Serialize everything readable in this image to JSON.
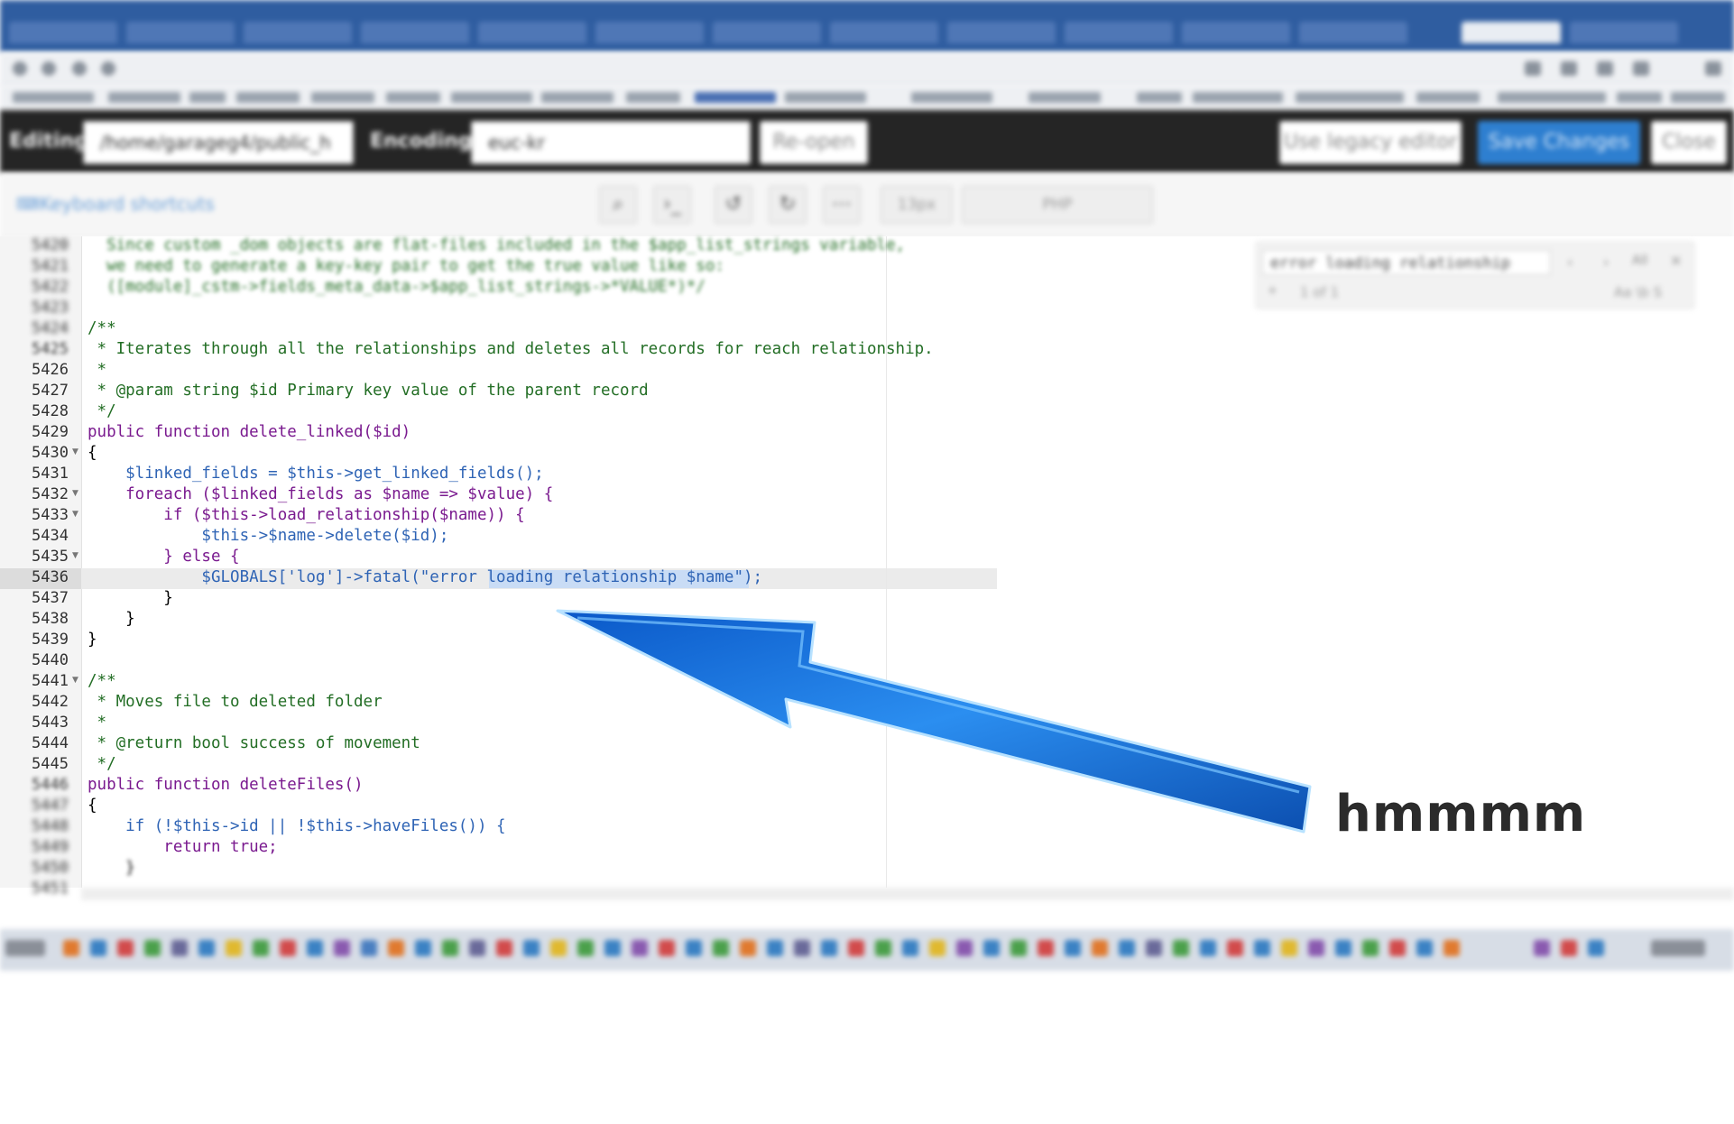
{
  "editor_bar": {
    "editing_label": "Editing:",
    "path": "/home/garageg4/public_h",
    "encoding_label": "Encoding:",
    "encoding_value": "euc-kr",
    "reopen_label": "Re-open",
    "legacy_label": "Use legacy editor",
    "save_label": "Save Changes",
    "close_label": "Close"
  },
  "toolbar": {
    "shortcuts_label": "Keyboard shortcuts",
    "font_size": "13px",
    "mode": "PHP"
  },
  "find": {
    "query": "error loading relationship",
    "count": "1 of 1",
    "options": "Aa \\b S"
  },
  "lines": [
    {
      "n": "5420",
      "text": "  Since custom _dom objects are flat-files included in the $app_list_strings variable,"
    },
    {
      "n": "5421",
      "text": "  we need to generate a key-key pair to get the true value like so:"
    },
    {
      "n": "5422",
      "text": "  ([module]_cstm->fields_meta_data->$app_list_strings->*VALUE*)*/"
    },
    {
      "n": "5423",
      "text": ""
    },
    {
      "n": "5424",
      "text": "/**"
    },
    {
      "n": "5425",
      "text": " * Iterates through all the relationships and deletes all records for reach relationship."
    },
    {
      "n": "5426",
      "text": " *"
    },
    {
      "n": "5427",
      "text": " * @param string $id Primary key value of the parent record"
    },
    {
      "n": "5428",
      "text": " */"
    },
    {
      "n": "5429",
      "text": "public function delete_linked($id)"
    },
    {
      "n": "5430",
      "text": "{"
    },
    {
      "n": "5431",
      "text": "    $linked_fields = $this->get_linked_fields();"
    },
    {
      "n": "5432",
      "text": "    foreach ($linked_fields as $name => $value) {"
    },
    {
      "n": "5433",
      "text": "        if ($this->load_relationship($name)) {"
    },
    {
      "n": "5434",
      "text": "            $this->$name->delete($id);"
    },
    {
      "n": "5435",
      "text": "        } else {"
    },
    {
      "n": "5436",
      "text": "            $GLOBALS['log']->fatal(\"error loading relationship $name\");"
    },
    {
      "n": "5437",
      "text": "        }"
    },
    {
      "n": "5438",
      "text": "    }"
    },
    {
      "n": "5439",
      "text": "}"
    },
    {
      "n": "5440",
      "text": ""
    },
    {
      "n": "5441",
      "text": "/**"
    },
    {
      "n": "5442",
      "text": " * Moves file to deleted folder"
    },
    {
      "n": "5443",
      "text": " *"
    },
    {
      "n": "5444",
      "text": " * @return bool success of movement"
    },
    {
      "n": "5445",
      "text": " */"
    },
    {
      "n": "5446",
      "text": "public function deleteFiles()"
    },
    {
      "n": "5447",
      "text": "{"
    },
    {
      "n": "5448",
      "text": "    if (!$this->id || !$this->haveFiles()) {"
    },
    {
      "n": "5449",
      "text": "        return true;"
    },
    {
      "n": "5450",
      "text": "    }"
    },
    {
      "n": "5451",
      "text": ""
    }
  ],
  "annotation": {
    "caption": "hmmmm",
    "arrow_color": "#1a7fe0"
  }
}
